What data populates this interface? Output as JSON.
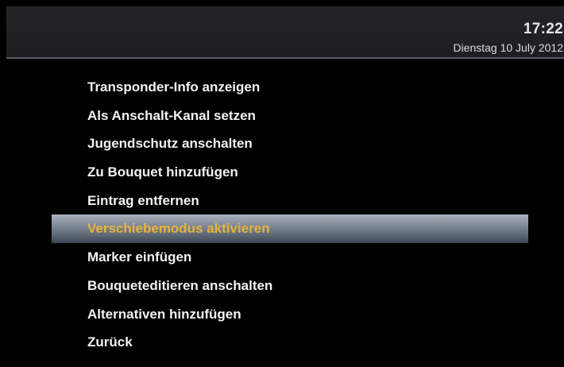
{
  "header": {
    "time": "17:22",
    "date": "Dienstag 10 July 2012"
  },
  "menu": {
    "selected_index": 5,
    "items": [
      {
        "label": "Transponder-Info anzeigen"
      },
      {
        "label": "Als Anschalt-Kanal setzen"
      },
      {
        "label": "Jugendschutz anschalten"
      },
      {
        "label": "Zu Bouquet hinzufügen"
      },
      {
        "label": "Eintrag entfernen"
      },
      {
        "label": "Verschiebemodus aktivieren"
      },
      {
        "label": "Marker einfügen"
      },
      {
        "label": "Bouqueteditieren anschalten"
      },
      {
        "label": "Alternativen hinzufügen"
      },
      {
        "label": "Zurück"
      }
    ]
  },
  "colors": {
    "text": "#f2f2f2",
    "selected_text": "#e6b43a",
    "highlight_bar": "#7f8995",
    "background": "#000000",
    "header_bg": "#242428"
  }
}
